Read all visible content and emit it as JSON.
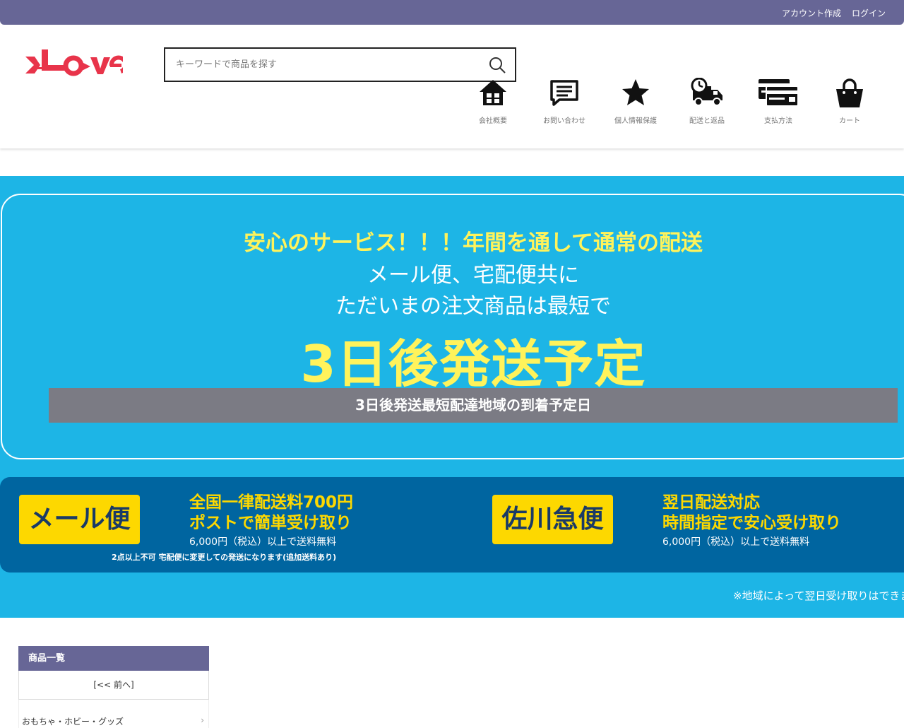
{
  "topbar": {
    "account_label": "アカウント作成",
    "login_label": "ログイン"
  },
  "search": {
    "placeholder": "キーワードで商品を探す"
  },
  "nav": [
    {
      "label": "会社概要",
      "icon": "house-icon"
    },
    {
      "label": "お問い合わせ",
      "icon": "message-icon"
    },
    {
      "label": "個人情報保護",
      "icon": "star-icon"
    },
    {
      "label": "配送と返品",
      "icon": "truck-clock-icon"
    },
    {
      "label": "支払方法",
      "icon": "credit-card-icon"
    },
    {
      "label": "カート",
      "icon": "shopping-bag-icon"
    }
  ],
  "promo": {
    "line1": "安心のサービス！！！年間を通して通常の配送",
    "line2": "メール便、宅配便共に",
    "line3": "ただいまの注文商品は最短で",
    "big": "3日後発送予定",
    "bar": "3日後発送最短配達地域の到着予定日"
  },
  "shipping": {
    "mail": {
      "button": "メール便",
      "title1": "全国一律配送料700円",
      "title2": "ポストで簡単受け取り",
      "note": "6,000円（税込）以上で送料無料",
      "warning": "2点以上不可 宅配便に変更しての発送になります(追加送料あり)"
    },
    "sagawa": {
      "button": "佐川急便",
      "title1": "翌日配送対応",
      "title2": "時間指定で安心受け取り",
      "note": "6,000円（税込）以上で送料無料"
    },
    "region_note": "※地域によって翌日受け取りはできません"
  },
  "sidebar": {
    "title": "商品一覧",
    "prev": "[<< 前へ]",
    "items": [
      {
        "label": "おもちゃ・ホビー・グッズ"
      }
    ]
  },
  "colors": {
    "topbar": "#676696",
    "banner": "#1db5e6",
    "shipping": "#0065a0",
    "accent_yellow": "#fdd800",
    "logo_red": "#e8344a"
  }
}
